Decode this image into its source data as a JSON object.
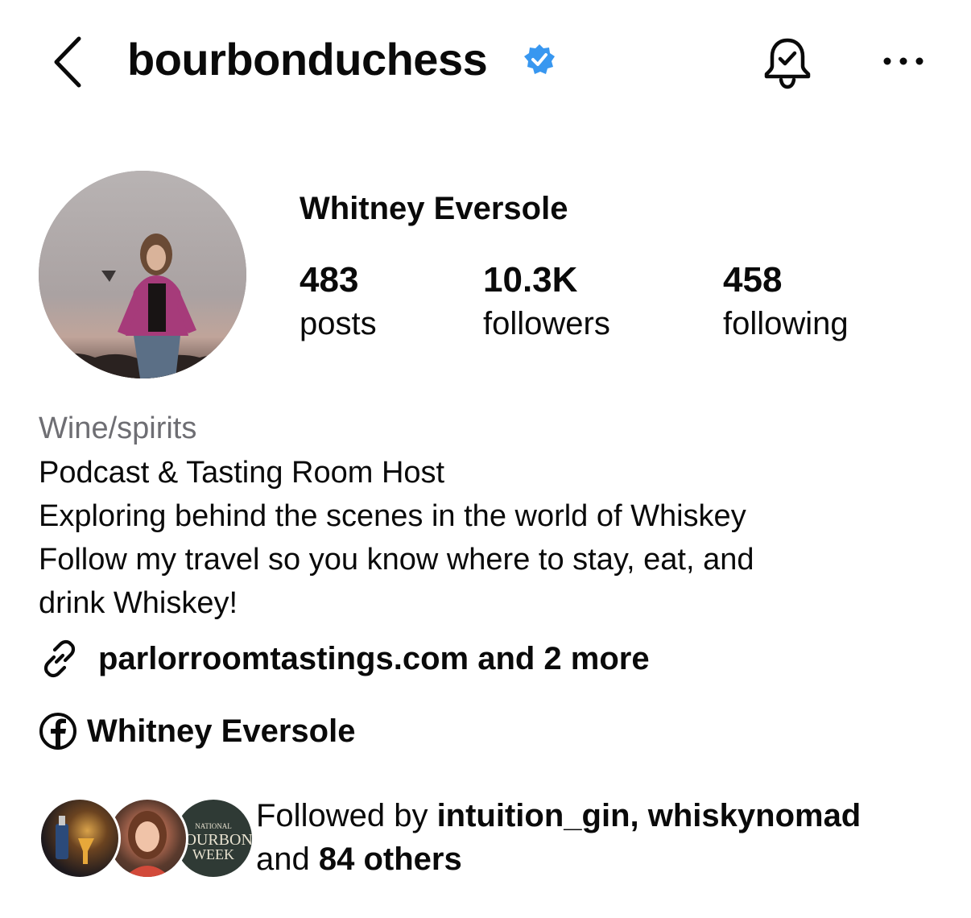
{
  "header": {
    "username": "bourbonduchess",
    "verified_color": "#3897f0"
  },
  "profile": {
    "display_name": "Whitney Eversole",
    "stats": {
      "posts": {
        "value": "483",
        "label": "posts"
      },
      "followers": {
        "value": "10.3K",
        "label": "followers"
      },
      "following": {
        "value": "458",
        "label": "following"
      }
    },
    "category": "Wine/spirits",
    "bio_lines": [
      "Podcast & Tasting Room Host",
      "Exploring behind the scenes in the world of Whiskey",
      "Follow my travel so you know where to stay, eat, and",
      "drink Whiskey!"
    ],
    "link": "parlorroomtastings.com and 2 more",
    "facebook_name": "Whitney Eversole"
  },
  "mutuals": {
    "prefix": "Followed by ",
    "names": "intuition_gin, whiskynomad",
    "and_text": "and ",
    "others": "84 others",
    "avatar3_text": [
      "NATIONAL",
      "BOURBON",
      "WEEK"
    ]
  }
}
